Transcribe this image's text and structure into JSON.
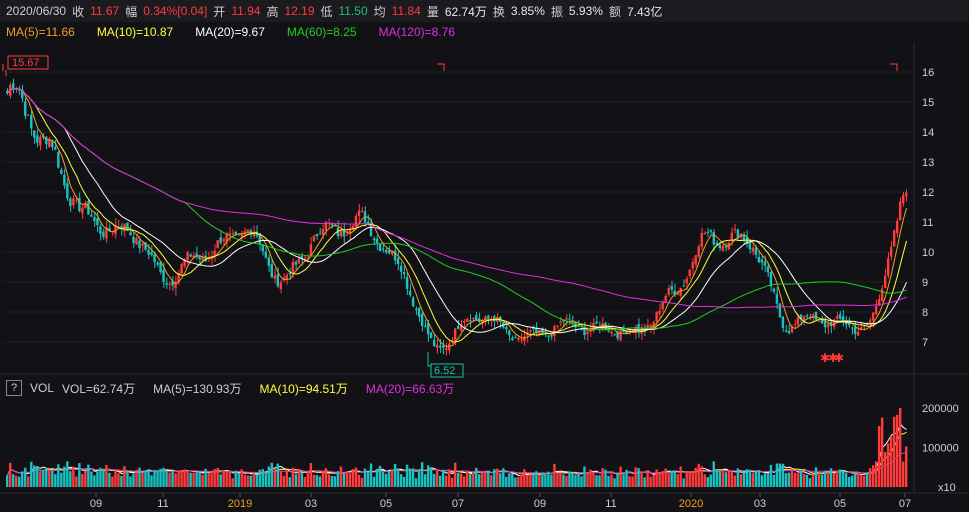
{
  "info": {
    "date": "2020/06/30",
    "close_label": "收",
    "close": "11.67",
    "change_label": "幅",
    "change": "0.34%[0.04]",
    "open_label": "开",
    "open": "11.94",
    "high_label": "高",
    "high": "12.19",
    "low_label": "低",
    "low": "11.50",
    "avg_label": "均",
    "avg": "11.84",
    "vol_label": "量",
    "vol": "62.74万",
    "turnover_label": "换",
    "turnover": "3.85%",
    "amp_label": "振",
    "amp": "5.93%",
    "amount_label": "额",
    "amount": "7.43亿"
  },
  "ma": [
    {
      "text": "MA(5)=11.66",
      "color": "#f0a020"
    },
    {
      "text": "MA(10)=10.87",
      "color": "#ffff40"
    },
    {
      "text": "MA(20)=9.67",
      "color": "#ffffff"
    },
    {
      "text": "MA(60)=8.25",
      "color": "#22cc22"
    },
    {
      "text": "MA(120)=8.76",
      "color": "#dd30dd"
    }
  ],
  "vol_header": {
    "help": "?",
    "title": "VOL",
    "vol": "VOL=62.74万",
    "ma5": "MA(5)=130.93万",
    "ma10": "MA(10)=94.51万",
    "ma20": "MA(20)=66.63万"
  },
  "price_axis": [
    "16",
    "15",
    "14",
    "13",
    "12",
    "11",
    "10",
    "9",
    "8",
    "7"
  ],
  "vol_axis": [
    "200000",
    "100000",
    "x10"
  ],
  "x_axis": [
    {
      "label": "09",
      "highlight": false
    },
    {
      "label": "11",
      "highlight": false
    },
    {
      "label": "2019",
      "highlight": true
    },
    {
      "label": "03",
      "highlight": false
    },
    {
      "label": "05",
      "highlight": false
    },
    {
      "label": "07",
      "highlight": false
    },
    {
      "label": "09",
      "highlight": false
    },
    {
      "label": "11",
      "highlight": false
    },
    {
      "label": "2020",
      "highlight": true
    },
    {
      "label": "03",
      "highlight": false
    },
    {
      "label": "05",
      "highlight": false
    },
    {
      "label": "07",
      "highlight": false
    }
  ],
  "annotations": {
    "high_marker": "15.67",
    "low_marker": "6.52"
  },
  "colors": {
    "up": "#ff3b3b",
    "down": "#19c3c3",
    "ma5": "#f0a020",
    "ma10": "#ffff40",
    "ma20": "#ffffff",
    "ma60": "#22cc22",
    "ma120": "#dd30dd"
  },
  "chart_data": {
    "type": "line",
    "title": "",
    "xlabel": "",
    "ylabel": "",
    "x": [
      "2018-07",
      "2018-08",
      "2018-09",
      "2018-10",
      "2018-11",
      "2018-12",
      "2019-01",
      "2019-02",
      "2019-03",
      "2019-04",
      "2019-05",
      "2019-06",
      "2019-07",
      "2019-08",
      "2019-09",
      "2019-10",
      "2019-11",
      "2019-12",
      "2020-01",
      "2020-02",
      "2020-03",
      "2020-04",
      "2020-05",
      "2020-06"
    ],
    "ylim": [
      6.2,
      16.5
    ],
    "series": [
      {
        "name": "",
        "values": [
          15.3,
          13.2,
          11.6,
          10.6,
          9.0,
          10.3,
          10.5,
          9.0,
          11.0,
          10.7,
          9.6,
          7.0,
          7.6,
          7.3,
          7.6,
          7.2,
          7.5,
          8.6,
          10.2,
          10.7,
          7.5,
          7.5,
          7.8,
          11.7
        ]
      }
    ],
    "vol_ylim": [
      0,
      220000
    ]
  }
}
